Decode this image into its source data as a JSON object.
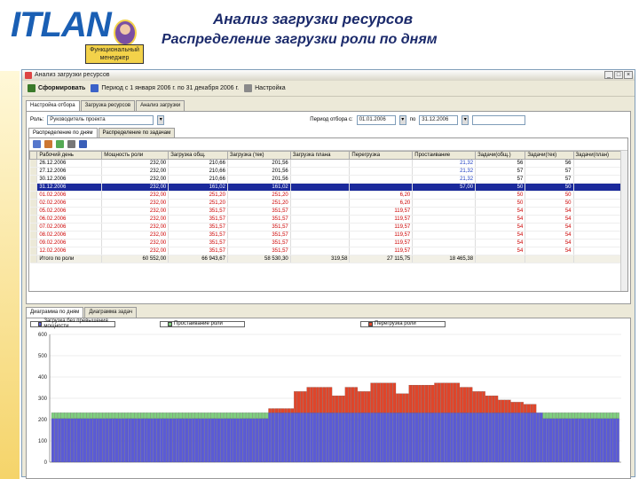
{
  "header": {
    "logo_text": "ITLAN",
    "logo_badge": "Функциональный менеджер",
    "title": "Анализ загрузки ресурсов",
    "subtitle": "Распределение загрузки роли по дням"
  },
  "window": {
    "title": "Анализ загрузки ресурсов",
    "controls": [
      "_",
      "□",
      "×"
    ]
  },
  "toolbar": {
    "form_label": "Сформировать",
    "period_label": "Период с 1 января 2006 г. по 31 декабря 2006 г.",
    "settings_label": "Настройка"
  },
  "tabs": [
    "Настройка отбора",
    "Загрузка ресурсов",
    "Анализ загрузки"
  ],
  "filter": {
    "role_label": "Роль:",
    "role_value": "Руководитель проекта",
    "period_label": "Период отбора с:",
    "date_from": "01.01.2006",
    "date_to_label": "по",
    "date_to": "31.12.2006"
  },
  "subtabs": [
    "Распределение по дням",
    "Распределение по задачам"
  ],
  "grid": {
    "columns": [
      "Рабочий день",
      "Мощность роли",
      "Загрузка общ.",
      "Загрузка (тек)",
      "Загрузка плана",
      "Перегрузка",
      "Простаивание",
      "Задачи(общ.)",
      "Задачи(тек)",
      "Задачи(план)"
    ],
    "rows": [
      {
        "day": "26.12.2006",
        "cap": "232,00",
        "tot": "210,66",
        "cur": "201,56",
        "plan": "",
        "over": "",
        "idle": "21,32",
        "t1": "56",
        "t2": "56",
        "t3": ""
      },
      {
        "day": "27.12.2006",
        "cap": "232,00",
        "tot": "210,66",
        "cur": "201,56",
        "plan": "",
        "over": "",
        "idle": "21,32",
        "t1": "57",
        "t2": "57",
        "t3": ""
      },
      {
        "day": "30.12.2006",
        "cap": "232,00",
        "tot": "210,66",
        "cur": "201,56",
        "plan": "",
        "over": "",
        "idle": "21,32",
        "t1": "57",
        "t2": "57",
        "t3": ""
      },
      {
        "day": "31.12.2006",
        "cap": "232,00",
        "tot": "161,02",
        "cur": "161,02",
        "plan": "",
        "over": "",
        "idle": "57,00",
        "t1": "50",
        "t2": "50",
        "t3": ""
      },
      {
        "day": "01.02.2006",
        "cap": "232,00",
        "tot": "251,20",
        "cur": "251,20",
        "plan": "",
        "over": "6,20",
        "idle": "",
        "t1": "50",
        "t2": "50",
        "t3": ""
      },
      {
        "day": "02.02.2006",
        "cap": "232,00",
        "tot": "251,20",
        "cur": "251,20",
        "plan": "",
        "over": "6,20",
        "idle": "",
        "t1": "50",
        "t2": "50",
        "t3": ""
      },
      {
        "day": "05.02.2006",
        "cap": "232,00",
        "tot": "351,57",
        "cur": "351,57",
        "plan": "",
        "over": "119,57",
        "idle": "",
        "t1": "54",
        "t2": "54",
        "t3": ""
      },
      {
        "day": "06.02.2006",
        "cap": "232,00",
        "tot": "351,57",
        "cur": "351,57",
        "plan": "",
        "over": "119,57",
        "idle": "",
        "t1": "54",
        "t2": "54",
        "t3": ""
      },
      {
        "day": "07.02.2006",
        "cap": "232,00",
        "tot": "351,57",
        "cur": "351,57",
        "plan": "",
        "over": "119,57",
        "idle": "",
        "t1": "54",
        "t2": "54",
        "t3": ""
      },
      {
        "day": "08.02.2006",
        "cap": "232,00",
        "tot": "351,57",
        "cur": "351,57",
        "plan": "",
        "over": "119,57",
        "idle": "",
        "t1": "54",
        "t2": "54",
        "t3": ""
      },
      {
        "day": "09.02.2006",
        "cap": "232,00",
        "tot": "351,57",
        "cur": "351,57",
        "plan": "",
        "over": "119,57",
        "idle": "",
        "t1": "54",
        "t2": "54",
        "t3": ""
      },
      {
        "day": "12.02.2006",
        "cap": "232,00",
        "tot": "351,57",
        "cur": "351,57",
        "plan": "",
        "over": "119,57",
        "idle": "",
        "t1": "54",
        "t2": "54",
        "t3": ""
      }
    ],
    "total": {
      "day": "Итого по роли",
      "cap": "60 552,00",
      "tot": "66 943,67",
      "cur": "58 530,30",
      "plan": "319,58",
      "over": "27 115,75",
      "idle": "18 465,38",
      "t1": "",
      "t2": "",
      "t3": ""
    }
  },
  "chart_tabs": [
    "Диаграмма по дням",
    "Диаграмма задач"
  ],
  "legend": [
    "Загрузка без превышения мощности",
    "Простаивание роли",
    "Перегрузка роли"
  ],
  "colors": {
    "normal": "#5b5bd6",
    "idle": "#7fcf7f",
    "over": "#e0452a"
  },
  "chart_data": {
    "type": "bar",
    "stacked": true,
    "ylim": [
      0,
      600
    ],
    "yticks": [
      "0",
      "100",
      "200",
      "300",
      "400",
      "500",
      "600"
    ],
    "series": [
      {
        "name": "Загрузка без превышения мощности",
        "values": [
          205,
          205,
          205,
          205,
          205,
          205,
          205,
          205,
          205,
          205,
          205,
          205,
          205,
          205,
          205,
          205,
          205,
          205,
          205,
          205,
          205,
          205,
          205,
          205,
          205,
          205,
          205,
          205,
          205,
          205,
          205,
          205,
          205,
          205,
          205,
          205,
          205,
          205,
          205,
          205,
          205,
          205,
          205,
          205,
          205,
          205,
          205,
          205,
          205,
          205,
          205,
          205,
          205,
          205,
          205,
          205,
          205,
          205,
          205,
          205,
          205,
          205,
          205,
          205,
          205,
          205,
          205,
          205,
          232,
          232,
          232,
          232,
          232,
          232,
          232,
          232,
          232,
          232,
          232,
          232,
          232,
          232,
          232,
          232,
          232,
          232,
          232,
          232,
          232,
          232,
          232,
          232,
          232,
          232,
          232,
          232,
          232,
          232,
          232,
          232,
          232,
          232,
          232,
          232,
          232,
          232,
          232,
          232,
          232,
          232,
          232,
          232,
          232,
          232,
          232,
          232,
          232,
          232,
          232,
          232,
          232,
          232,
          232,
          232,
          232,
          232,
          232,
          232,
          232,
          232,
          232,
          232,
          232,
          232,
          232,
          232,
          232,
          232,
          232,
          232,
          232,
          232,
          232,
          232,
          232,
          232,
          232,
          232,
          232,
          232,
          232,
          232,
          232,
          232,
          205,
          205,
          205,
          205,
          205,
          205,
          205,
          205,
          205,
          205,
          205,
          205,
          205,
          205,
          205,
          205,
          205,
          205,
          205,
          205,
          205,
          205,
          205,
          205
        ]
      },
      {
        "name": "Простаивание роли",
        "values": [
          27,
          27,
          27,
          27,
          27,
          27,
          27,
          27,
          27,
          27,
          27,
          27,
          27,
          27,
          27,
          27,
          27,
          27,
          27,
          27,
          27,
          27,
          27,
          27,
          27,
          27,
          27,
          27,
          27,
          27,
          27,
          27,
          27,
          27,
          27,
          27,
          27,
          27,
          27,
          27,
          27,
          27,
          27,
          27,
          27,
          27,
          27,
          27,
          27,
          27,
          27,
          27,
          27,
          27,
          27,
          27,
          27,
          27,
          27,
          27,
          27,
          27,
          27,
          27,
          27,
          27,
          27,
          27,
          0,
          0,
          0,
          0,
          0,
          0,
          0,
          0,
          0,
          0,
          0,
          0,
          0,
          0,
          0,
          0,
          0,
          0,
          0,
          0,
          0,
          0,
          0,
          0,
          0,
          0,
          0,
          0,
          0,
          0,
          0,
          0,
          0,
          0,
          0,
          0,
          0,
          0,
          0,
          0,
          0,
          0,
          0,
          0,
          0,
          0,
          0,
          0,
          0,
          0,
          0,
          0,
          0,
          0,
          0,
          0,
          0,
          0,
          0,
          0,
          0,
          0,
          0,
          0,
          0,
          0,
          0,
          0,
          0,
          0,
          0,
          0,
          0,
          0,
          0,
          0,
          0,
          0,
          0,
          0,
          0,
          0,
          0,
          0,
          0,
          0,
          27,
          27,
          27,
          27,
          27,
          27,
          27,
          27,
          27,
          27,
          27,
          27,
          27,
          27,
          27,
          27,
          27,
          27,
          27,
          27,
          27,
          27,
          27,
          27
        ]
      },
      {
        "name": "Перегрузка роли",
        "values": [
          0,
          0,
          0,
          0,
          0,
          0,
          0,
          0,
          0,
          0,
          0,
          0,
          0,
          0,
          0,
          0,
          0,
          0,
          0,
          0,
          0,
          0,
          0,
          0,
          0,
          0,
          0,
          0,
          0,
          0,
          0,
          0,
          0,
          0,
          0,
          0,
          0,
          0,
          0,
          0,
          0,
          0,
          0,
          0,
          0,
          0,
          0,
          0,
          0,
          0,
          0,
          0,
          0,
          0,
          0,
          0,
          0,
          0,
          0,
          0,
          0,
          0,
          0,
          0,
          0,
          0,
          0,
          0,
          20,
          20,
          20,
          20,
          20,
          20,
          20,
          20,
          100,
          100,
          100,
          100,
          120,
          120,
          120,
          120,
          120,
          120,
          120,
          120,
          80,
          80,
          80,
          80,
          120,
          120,
          120,
          120,
          100,
          100,
          100,
          100,
          140,
          140,
          140,
          140,
          140,
          140,
          140,
          140,
          90,
          90,
          90,
          90,
          130,
          130,
          130,
          130,
          130,
          130,
          130,
          130,
          140,
          140,
          140,
          140,
          140,
          140,
          140,
          140,
          120,
          120,
          120,
          120,
          100,
          100,
          100,
          100,
          80,
          80,
          80,
          80,
          60,
          60,
          60,
          60,
          50,
          50,
          50,
          50,
          40,
          40,
          40,
          40,
          0,
          0,
          0,
          0,
          0,
          0,
          0,
          0,
          0,
          0,
          0,
          0,
          0,
          0,
          0,
          0,
          0,
          0,
          0,
          0,
          0,
          0,
          0,
          0
        ]
      }
    ]
  }
}
